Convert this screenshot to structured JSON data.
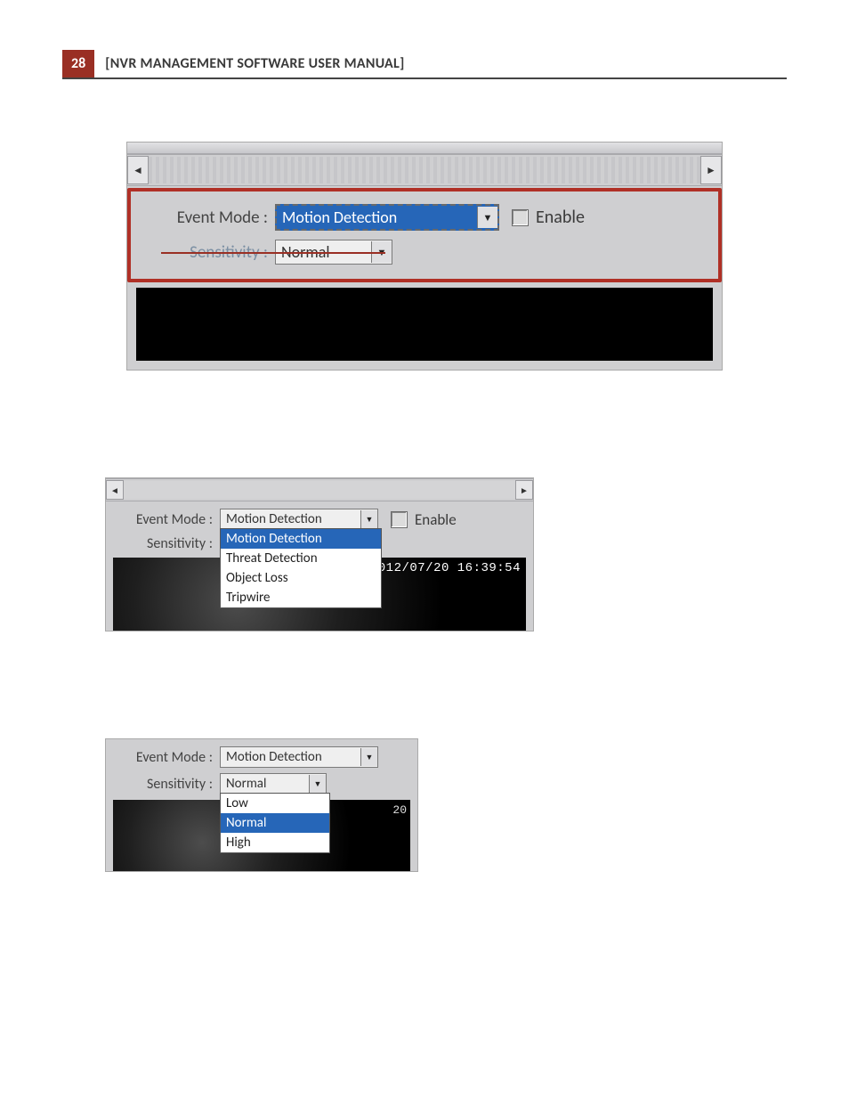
{
  "header": {
    "page_number": "28",
    "title": "[NVR MANAGEMENT SOFTWARE USER MANUAL]"
  },
  "fig1": {
    "event_mode_label": "Event Mode :",
    "event_mode_value": "Motion Detection",
    "enable_label": "Enable",
    "sensitivity_label": "Sensitivity :",
    "sensitivity_value": "Normal"
  },
  "fig2": {
    "event_mode_label": "Event Mode :",
    "event_mode_value": "Motion Detection",
    "enable_label": "Enable",
    "sensitivity_label": "Sensitivity :",
    "options": [
      "Motion Detection",
      "Threat Detection",
      "Object Loss",
      "Tripwire"
    ],
    "selected_index": 0,
    "timestamp": "2012/07/20 16:39:54"
  },
  "fig3": {
    "event_mode_label": "Event Mode :",
    "event_mode_value": "Motion Detection",
    "sensitivity_label": "Sensitivity :",
    "sensitivity_value": "Normal",
    "options": [
      "Low",
      "Normal",
      "High"
    ],
    "selected_index": 1,
    "corner": "20"
  }
}
